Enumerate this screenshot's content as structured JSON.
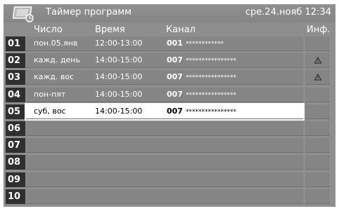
{
  "header": {
    "title": "Таймер программ",
    "datetime": "сре.24.нояб 12:34"
  },
  "columns": {
    "date": "Число",
    "time": "Время",
    "channel": "Канал",
    "info": "Инф."
  },
  "rows": [
    {
      "num": "01",
      "day": "пон.05.янв",
      "time": "12:00-13:00",
      "channel": "001",
      "name": "************",
      "warning": false,
      "selected": false
    },
    {
      "num": "02",
      "day": "кажд. день",
      "time": "14:00-15:00",
      "channel": "007",
      "name": "****************",
      "warning": true,
      "selected": false
    },
    {
      "num": "03",
      "day": "кажд. вос",
      "time": "14:00-15:00",
      "channel": "007",
      "name": "****************",
      "warning": true,
      "selected": false
    },
    {
      "num": "04",
      "day": "пон-пят",
      "time": "14:00-15:00",
      "channel": "007",
      "name": "****************",
      "warning": false,
      "selected": false
    },
    {
      "num": "05",
      "day": "суб, вос",
      "time": "14:00-15:00",
      "channel": "007",
      "name": "****************",
      "warning": false,
      "selected": true
    },
    {
      "num": "06",
      "day": "",
      "time": "",
      "channel": "",
      "name": "",
      "warning": false,
      "selected": false
    },
    {
      "num": "07",
      "day": "",
      "time": "",
      "channel": "",
      "name": "",
      "warning": false,
      "selected": false
    },
    {
      "num": "08",
      "day": "",
      "time": "",
      "channel": "",
      "name": "",
      "warning": false,
      "selected": false
    },
    {
      "num": "09",
      "day": "",
      "time": "",
      "channel": "",
      "name": "",
      "warning": false,
      "selected": false
    },
    {
      "num": "10",
      "day": "",
      "time": "",
      "channel": "",
      "name": "",
      "warning": false,
      "selected": false
    }
  ],
  "icons": {
    "logo": "timer-screen-icon",
    "warning": "warning-triangle-icon"
  }
}
